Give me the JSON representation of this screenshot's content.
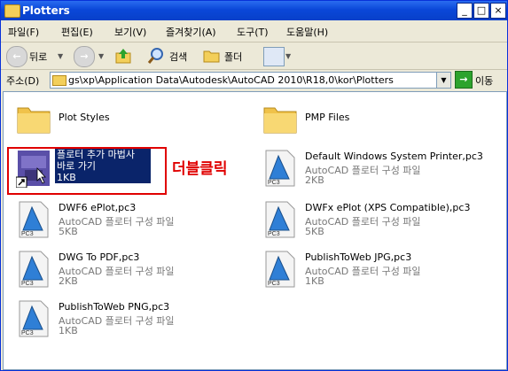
{
  "window": {
    "title": "Plotters"
  },
  "menu": [
    "파일(F)",
    "편집(E)",
    "보기(V)",
    "즐겨찾기(A)",
    "도구(T)",
    "도움말(H)"
  ],
  "toolbar": {
    "back": "뒤로",
    "search": "검색",
    "folders": "폴더"
  },
  "address": {
    "label": "주소(D)",
    "value": "gs\\xp\\Application Data\\Autodesk\\AutoCAD 2010\\R18,0\\kor\\Plotters",
    "go": "이동"
  },
  "annotation": "더블클릭",
  "items": [
    {
      "name": "Plot Styles",
      "type": "",
      "size": ""
    },
    {
      "name": "PMP Files",
      "type": "",
      "size": ""
    },
    {
      "name": "플로터 추가 마법사",
      "name2": "바로 가기",
      "type": "",
      "size": "1KB"
    },
    {
      "name": "Default Windows System Printer,pc3",
      "type": "AutoCAD 플로터 구성 파일",
      "size": "2KB"
    },
    {
      "name": "DWF6 ePlot,pc3",
      "type": "AutoCAD 플로터 구성 파일",
      "size": "5KB"
    },
    {
      "name": "DWFx ePlot (XPS Compatible),pc3",
      "type": "AutoCAD 플로터 구성 파일",
      "size": "5KB"
    },
    {
      "name": "DWG To PDF,pc3",
      "type": "AutoCAD 플로터 구성 파일",
      "size": "2KB"
    },
    {
      "name": "PublishToWeb JPG,pc3",
      "type": "AutoCAD 플로터 구성 파일",
      "size": "1KB"
    },
    {
      "name": "PublishToWeb PNG,pc3",
      "type": "AutoCAD 플로터 구성 파일",
      "size": "1KB"
    }
  ],
  "pc3_tag": "PC3"
}
